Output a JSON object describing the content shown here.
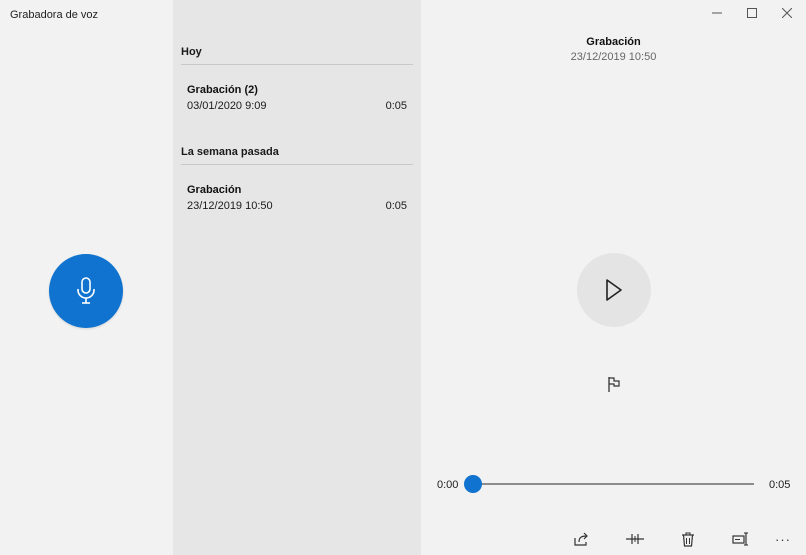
{
  "app": {
    "title": "Grabadora de voz"
  },
  "colors": {
    "accent": "#0f73cf",
    "list_bg": "#e6e6e6",
    "window_bg": "#f2f2f2"
  },
  "record": {
    "icon": "microphone-icon"
  },
  "list": {
    "groups": [
      {
        "header": "Hoy",
        "items": [
          {
            "name": "Grabación (2)",
            "date": "03/01/2020 9:09",
            "duration": "0:05"
          }
        ]
      },
      {
        "header": "La semana pasada",
        "items": [
          {
            "name": "Grabación",
            "date": "23/12/2019 10:50",
            "duration": "0:05"
          }
        ]
      }
    ]
  },
  "window_controls": {
    "minimize": "─",
    "maximize": "☐",
    "close": "✕"
  },
  "detail": {
    "title": "Grabación",
    "date": "23/12/2019 10:50",
    "play_icon": "play-icon",
    "marker_icon": "flag-icon",
    "playback": {
      "current": "0:00",
      "total": "0:05",
      "progress": 0
    }
  },
  "toolbar": {
    "icons": [
      "share-icon",
      "trim-icon",
      "delete-icon",
      "rename-icon",
      "more-icon"
    ],
    "more_label": "···"
  }
}
